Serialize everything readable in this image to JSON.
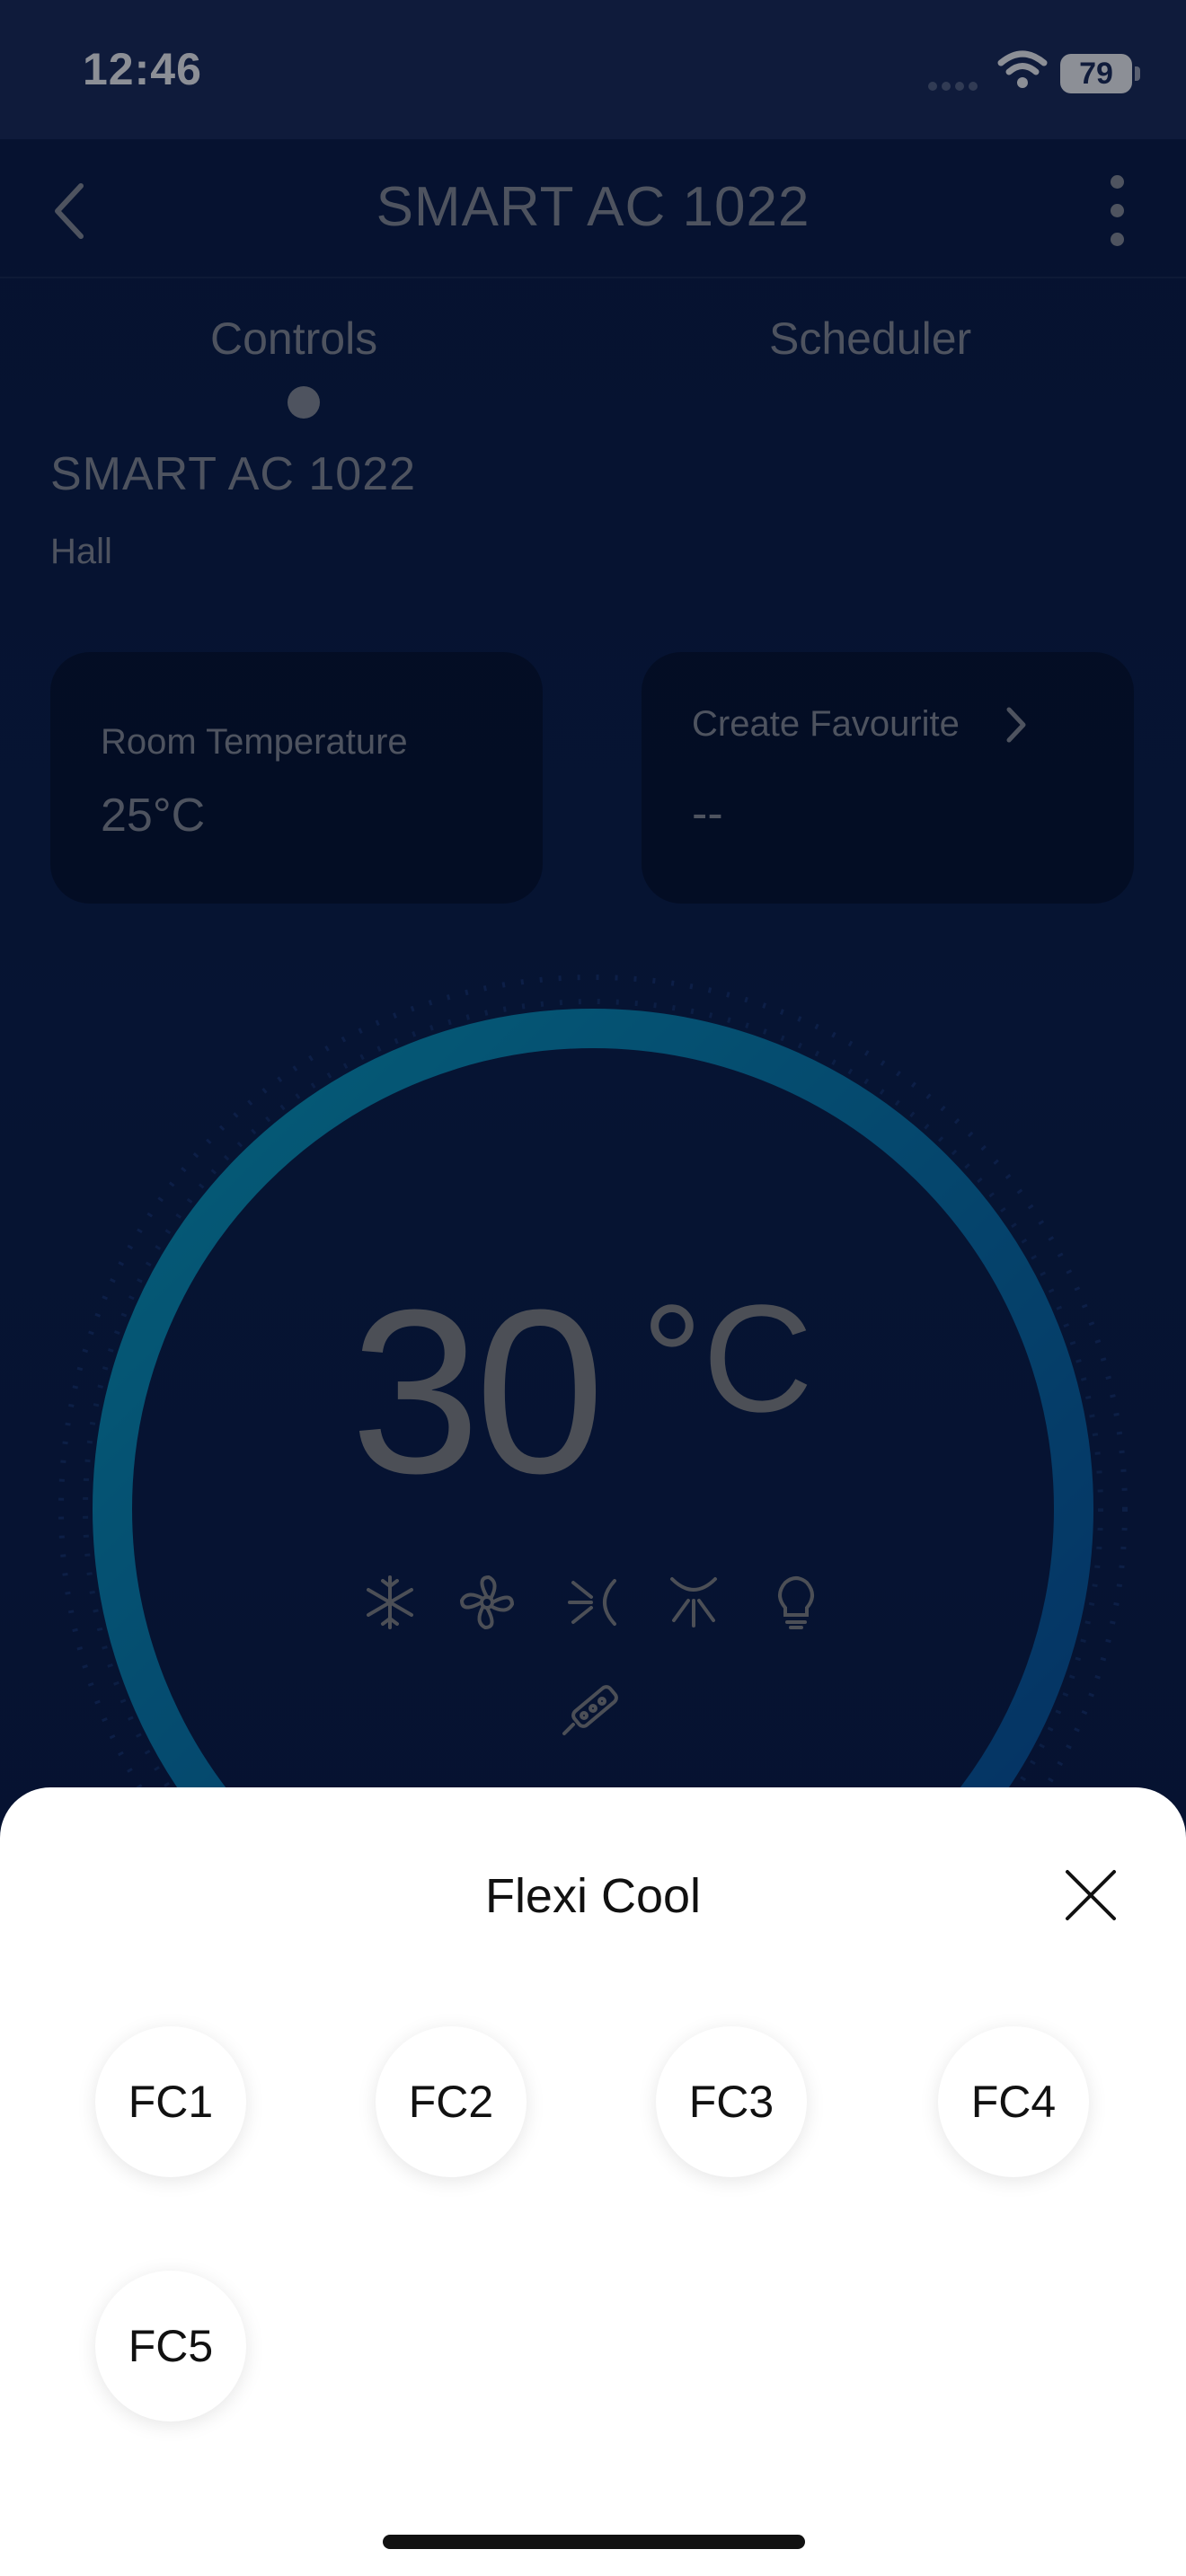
{
  "status_bar": {
    "time": "12:46",
    "battery": "79"
  },
  "header": {
    "title": "SMART AC 1022"
  },
  "tabs": [
    {
      "label": "Controls",
      "active": true
    },
    {
      "label": "Scheduler",
      "active": false
    }
  ],
  "device": {
    "name": "SMART AC 1022",
    "room": "Hall"
  },
  "cards": {
    "room_temperature": {
      "label": "Room Temperature",
      "value": "25°C"
    },
    "favourite": {
      "label": "Create Favourite",
      "value": "--"
    }
  },
  "dial": {
    "temperature": "30",
    "unit": "°C",
    "mode_icons": [
      "snowflake-icon",
      "fan-icon",
      "swing-horizontal-icon",
      "swing-vertical-icon",
      "light-bulb-icon",
      "filter-icon"
    ]
  },
  "sheet": {
    "title": "Flexi Cool",
    "options": [
      "FC1",
      "FC2",
      "FC3",
      "FC4",
      "FC5"
    ]
  },
  "colors": {
    "background": "#0b1f4b",
    "status_bar": "#1c2c59",
    "ring_accent": "#0aa3c8",
    "sheet": "#ffffff"
  }
}
